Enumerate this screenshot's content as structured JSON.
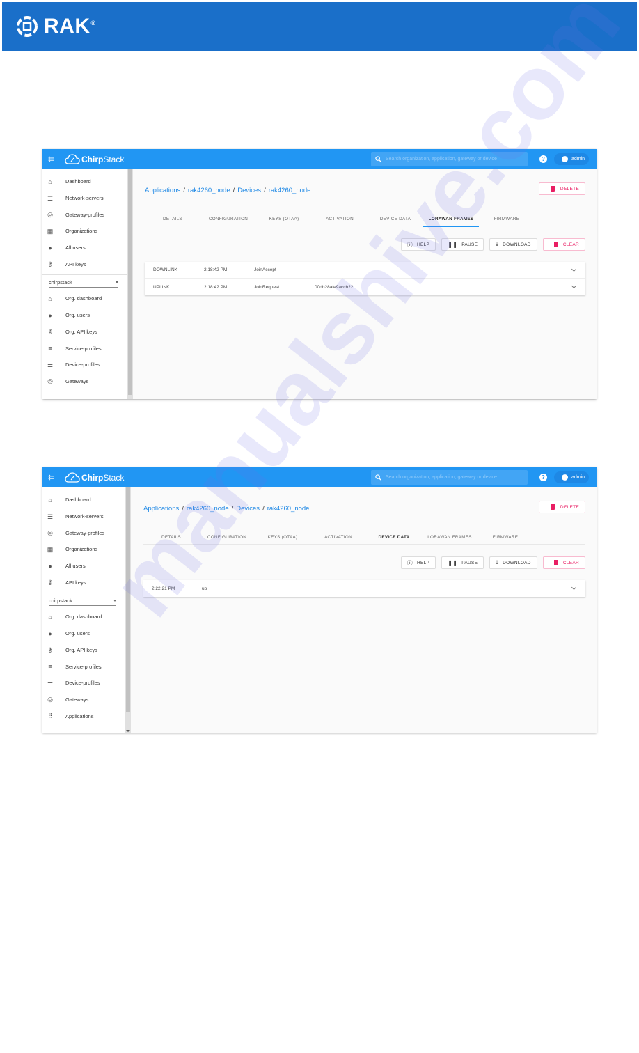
{
  "brand": {
    "name": "RAK",
    "registered_mark": "®",
    "color": "#1a6fc9"
  },
  "screenshots": [
    {
      "app": {
        "name_bold": "Chirp",
        "name_rest": "Stack",
        "search_placeholder": "Search organization, application, gateway or device",
        "user": "admin",
        "help_glyph": "?"
      },
      "sidebar": {
        "global_items": [
          {
            "label": "Dashboard",
            "icon": "home-icon"
          },
          {
            "label": "Network-servers",
            "icon": "server-icon"
          },
          {
            "label": "Gateway-profiles",
            "icon": "radio-tower-icon"
          },
          {
            "label": "Organizations",
            "icon": "domain-icon"
          },
          {
            "label": "All users",
            "icon": "user-icon"
          },
          {
            "label": "API keys",
            "icon": "key-icon"
          }
        ],
        "org_select": "chirpstack",
        "org_items": [
          {
            "label": "Org. dashboard",
            "icon": "home-icon"
          },
          {
            "label": "Org. users",
            "icon": "user-icon"
          },
          {
            "label": "Org. API keys",
            "icon": "key-icon"
          },
          {
            "label": "Service-profiles",
            "icon": "account-details-icon"
          },
          {
            "label": "Device-profiles",
            "icon": "tune-icon"
          },
          {
            "label": "Gateways",
            "icon": "radio-tower-icon"
          }
        ]
      },
      "breadcrumb": [
        "Applications",
        "rak4260_node",
        "Devices",
        "rak4260_node"
      ],
      "delete_label": "DELETE",
      "tabs": [
        "DETAILS",
        "CONFIGURATION",
        "KEYS (OTAA)",
        "ACTIVATION",
        "DEVICE DATA",
        "LORAWAN FRAMES",
        "FIRMWARE"
      ],
      "active_tab": "LORAWAN FRAMES",
      "actions": {
        "help": "HELP",
        "pause": "PAUSE",
        "download": "DOWNLOAD",
        "clear": "CLEAR"
      },
      "rows": [
        {
          "direction": "DOWNLINK",
          "time": "2:18:42 PM",
          "type": "JoinAccept",
          "extra": ""
        },
        {
          "direction": "UPLINK",
          "time": "2:18:42 PM",
          "type": "JoinRequest",
          "extra": "00db28afe9accb22"
        }
      ]
    },
    {
      "app": {
        "name_bold": "Chirp",
        "name_rest": "Stack",
        "search_placeholder": "Search organization, application, gateway or device",
        "user": "admin",
        "help_glyph": "?"
      },
      "sidebar": {
        "global_items": [
          {
            "label": "Dashboard",
            "icon": "home-icon"
          },
          {
            "label": "Network-servers",
            "icon": "server-icon"
          },
          {
            "label": "Gateway-profiles",
            "icon": "radio-tower-icon"
          },
          {
            "label": "Organizations",
            "icon": "domain-icon"
          },
          {
            "label": "All users",
            "icon": "user-icon"
          },
          {
            "label": "API keys",
            "icon": "key-icon"
          }
        ],
        "org_select": "chirpstack",
        "org_items": [
          {
            "label": "Org. dashboard",
            "icon": "home-icon"
          },
          {
            "label": "Org. users",
            "icon": "user-icon"
          },
          {
            "label": "Org. API keys",
            "icon": "key-icon"
          },
          {
            "label": "Service-profiles",
            "icon": "account-details-icon"
          },
          {
            "label": "Device-profiles",
            "icon": "tune-icon"
          },
          {
            "label": "Gateways",
            "icon": "radio-tower-icon"
          },
          {
            "label": "Applications",
            "icon": "apps-icon"
          }
        ]
      },
      "breadcrumb": [
        "Applications",
        "rak4260_node",
        "Devices",
        "rak4260_node"
      ],
      "delete_label": "DELETE",
      "tabs": [
        "DETAILS",
        "CONFIGURATION",
        "KEYS (OTAA)",
        "ACTIVATION",
        "DEVICE DATA",
        "LORAWAN FRAMES",
        "FIRMWARE"
      ],
      "active_tab": "DEVICE DATA",
      "actions": {
        "help": "HELP",
        "pause": "PAUSE",
        "download": "DOWNLOAD",
        "clear": "CLEAR"
      },
      "rows": [
        {
          "time": "2:22:21 PM",
          "type": "up"
        }
      ]
    }
  ],
  "watermark": "manualshive.com"
}
